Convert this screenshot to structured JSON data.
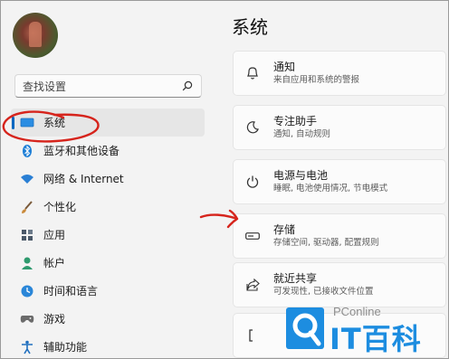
{
  "sidebar": {
    "search_placeholder": "查找设置",
    "items": [
      {
        "label": "系统",
        "icon": "monitor-icon"
      },
      {
        "label": "蓝牙和其他设备",
        "icon": "bluetooth-icon"
      },
      {
        "label": "网络 & Internet",
        "icon": "wifi-icon"
      },
      {
        "label": "个性化",
        "icon": "brush-icon"
      },
      {
        "label": "应用",
        "icon": "apps-icon"
      },
      {
        "label": "帐户",
        "icon": "person-icon"
      },
      {
        "label": "时间和语言",
        "icon": "globe-clock-icon"
      },
      {
        "label": "游戏",
        "icon": "gamepad-icon"
      },
      {
        "label": "辅助功能",
        "icon": "accessibility-icon"
      }
    ]
  },
  "main": {
    "title": "系统",
    "cards": [
      {
        "title": "通知",
        "subtitle": "来自应用和系统的警报",
        "icon": "bell-icon"
      },
      {
        "title": "专注助手",
        "subtitle": "通知, 自动规则",
        "icon": "moon-icon"
      },
      {
        "title": "电源与电池",
        "subtitle": "睡眠, 电池使用情况, 节电模式",
        "icon": "power-icon"
      },
      {
        "title": "存储",
        "subtitle": "存储空间, 驱动器, 配置规则",
        "icon": "storage-icon"
      },
      {
        "title": "就近共享",
        "subtitle": "可发现性, 已接收文件位置",
        "icon": "share-icon"
      }
    ]
  },
  "watermark": {
    "brand": "PConline",
    "logo_text": "IT百科"
  },
  "colors": {
    "accent": "#0067c0",
    "annotation": "#d6241c",
    "watermark": "#1d8de0"
  }
}
